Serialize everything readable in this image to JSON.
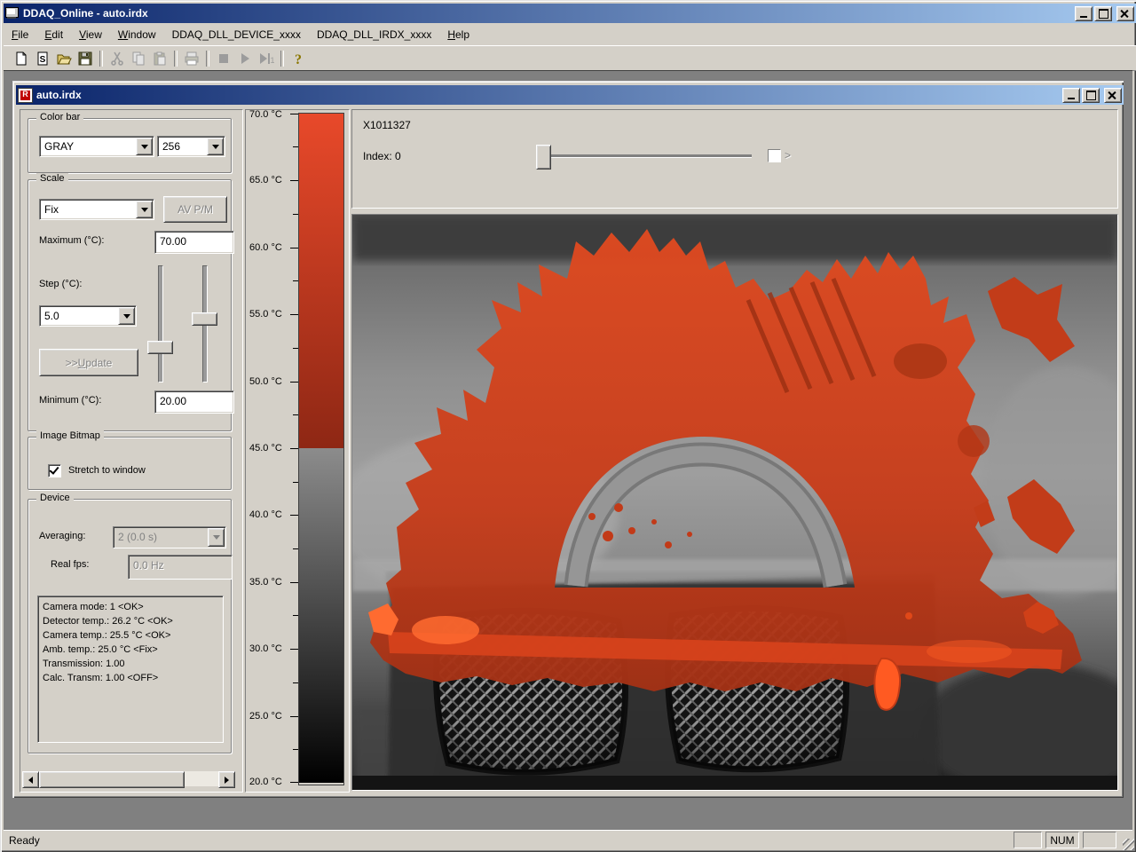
{
  "window": {
    "title": "DDAQ_Online - auto.irdx",
    "status_ready": "Ready",
    "status_num": "NUM"
  },
  "menu": {
    "items": [
      "File",
      "Edit",
      "View",
      "Window",
      "DDAQ_DLL_DEVICE_xxxx",
      "DDAQ_DLL_IRDX_xxxx",
      "Help"
    ]
  },
  "toolbar": {
    "icons": [
      "new-document",
      "new-irdx-document",
      "open-folder",
      "save-floppy",
      "cut",
      "copy",
      "paste",
      "print",
      "stop",
      "play",
      "step-one",
      "help"
    ]
  },
  "document": {
    "title": "auto.irdx",
    "colorbar": {
      "legend": "Color bar",
      "palette_value": "GRAY",
      "levels_value": "256"
    },
    "scale": {
      "legend": "Scale",
      "mode_value": "Fix",
      "avpm_button": "AV P/M",
      "maximum_label": "Maximum (°C):",
      "maximum_value": "70.00",
      "step_label": "Step (°C):",
      "step_value": "5.0",
      "update_button": ">> Update",
      "minimum_label": "Minimum (°C):",
      "minimum_value": "20.00"
    },
    "image_bitmap": {
      "legend": "Image Bitmap",
      "stretch_label": "Stretch to window",
      "stretch_checked": true
    },
    "device": {
      "legend": "Device",
      "averaging_label": "Averaging:",
      "averaging_value": "2 (0.0 s)",
      "fps_label": "Real fps:",
      "fps_value": "0.0 Hz",
      "status_lines": [
        "Camera mode: 1 <OK>",
        "Detector temp.: 26.2 °C <OK>",
        "Camera temp.: 25.5 °C <OK>",
        "Amb. temp.: 25.0 °C <Fix>",
        "Transmission: 1.00",
        "Calc. Transm: 1.00 <OFF>"
      ]
    },
    "viewer": {
      "camera_id": "X1011327",
      "index_label": "Index: 0",
      "next_glyph": ">"
    }
  },
  "color_scale": {
    "unit": "°C",
    "max": 70.0,
    "min": 20.0,
    "step": 5.0,
    "tick_labels": [
      "70.0 °C",
      "65.0 °C",
      "60.0 °C",
      "55.0 °C",
      "50.0 °C",
      "45.0 °C",
      "40.0 °C",
      "35.0 °C",
      "30.0 °C",
      "25.0 °C",
      "20.0 °C"
    ],
    "red_range": [
      45.0,
      70.0
    ],
    "gray_range": [
      20.0,
      45.0
    ],
    "colors": {
      "red_top": "#e8492a",
      "red_bottom": "#8e2714",
      "gray_top": "#8c8c8c",
      "gray_bottom": "#000000"
    }
  },
  "colors": {
    "titlebar_left": "#0a246a",
    "titlebar_right": "#a6caf0",
    "chrome": "#d4d0c8",
    "mdi_background": "#808080",
    "hot_overlay": "#d63f1e"
  }
}
